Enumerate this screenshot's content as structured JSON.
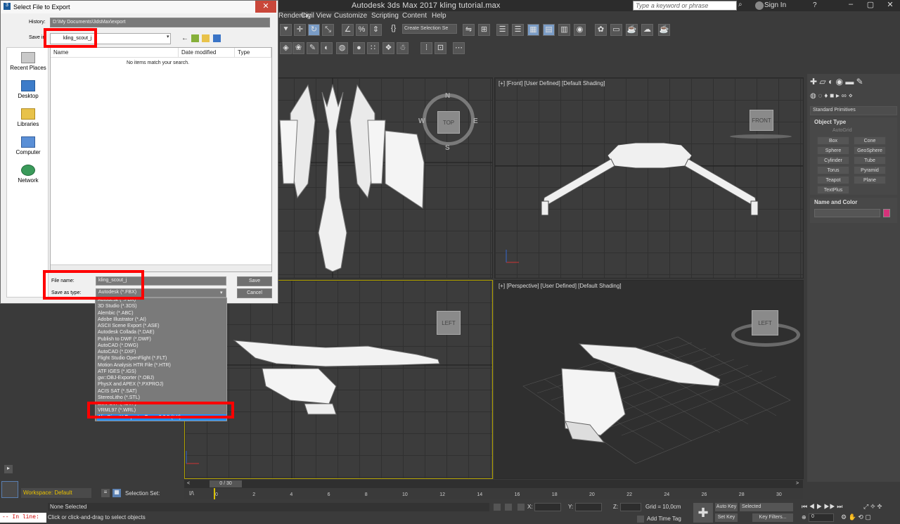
{
  "app": {
    "title": "Autodesk 3ds Max 2017     kling tutorial.max",
    "search_placeholder": "Type a keyword or phrase",
    "sign_in": "Sign In",
    "help": "?"
  },
  "menu": [
    "Rendering",
    "Civil View",
    "Customize",
    "Scripting",
    "Content",
    "Help"
  ],
  "toolbar": {
    "selection_set": "Create Selection Se"
  },
  "viewports": {
    "front_label": "[+] [Front] [User Defined] [Default Shading]",
    "perspective_label": "[+] [Perspective] [User Defined] [Default Shading]",
    "top_cube": "TOP",
    "front_cube": "FRONT",
    "left_cube": "LEFT",
    "compass": {
      "n": "N",
      "s": "S",
      "e": "E",
      "w": "W"
    }
  },
  "command_panel": {
    "category": "Standard Primitives",
    "object_type_title": "Object Type",
    "autogrid": "AutoGrid",
    "buttons": [
      "Box",
      "Cone",
      "Sphere",
      "GeoSphere",
      "Cylinder",
      "Tube",
      "Torus",
      "Pyramid",
      "Teapot",
      "Plane",
      "TextPlus"
    ],
    "name_color_title": "Name and Color",
    "object_color": "#d6327a"
  },
  "dialog": {
    "title": "Select File to Export",
    "history_label": "History:",
    "history_value": "D:\\My Documents\\3dsMax\\export",
    "save_in_label": "Save in:",
    "save_in_value": "kling_scout_j",
    "places": [
      "Recent Places",
      "Desktop",
      "Libraries",
      "Computer",
      "Network"
    ],
    "columns": [
      "Name",
      "Date modified",
      "Type"
    ],
    "empty_message": "No items match your search.",
    "file_name_label": "File name:",
    "file_name_value": "kling_scout_j",
    "save_as_type_label": "Save as type:",
    "save_as_type_value": "Autodesk (*.FBX)",
    "save_button": "Save",
    "cancel_button": "Cancel",
    "file_types": [
      "Autodesk (*.FBX)",
      "3D Studio (*.3DS)",
      "Alembic (*.ABC)",
      "Adobe Illustrator (*.AI)",
      "ASCII Scene Export (*.ASE)",
      "Autodesk Collada (*.DAE)",
      "Publish to DWF (*.DWF)",
      "AutoCAD (*.DWG)",
      "AutoCAD (*.DXF)",
      "Flight Studio OpenFlight (*.FLT)",
      "Motion Analysis HTR File (*.HTR)",
      "ATF IGES (*.IGS)",
      "gw::OBJ-Exporter (*.OBJ)",
      "PhysX and APEX (*.PXPROJ)",
      "ACIS SAT (*.SAT)",
      "StereoLitho (*.STL)",
      "LMV SVF (*.SVF)",
      "VRML97 (*.WRL)",
      "Alin DirectX Exporter Free v2.2.5 (*.X)"
    ],
    "selected_type_index": 18
  },
  "timeline": {
    "frame": "0 / 30",
    "ticks": [
      "0",
      "2",
      "4",
      "6",
      "8",
      "10",
      "12",
      "14",
      "16",
      "18",
      "20",
      "22",
      "24",
      "26",
      "28",
      "30"
    ]
  },
  "status": {
    "workspace": "Workspace: Default",
    "selection_set_label": "Selection Set:",
    "none_selected": "None Selected",
    "prompt": "Click or click-and-drag to select objects",
    "maxscript": "-- In line:",
    "x_label": "X:",
    "y_label": "Y:",
    "z_label": "Z:",
    "grid": "Grid = 10,0cm",
    "add_time_tag": "Add Time Tag",
    "auto_key": "Auto Key",
    "set_key": "Set Key",
    "selected": "Selected",
    "key_filters": "Key Filters...",
    "frame_value": "0"
  }
}
